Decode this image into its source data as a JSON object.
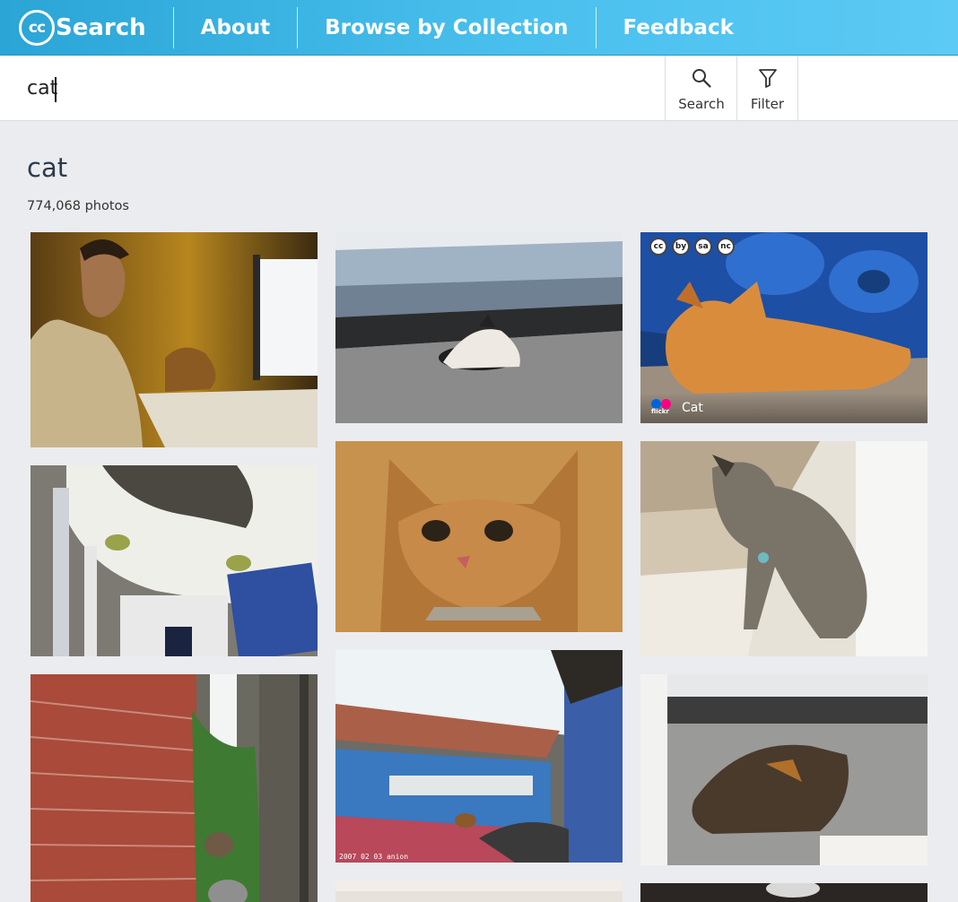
{
  "header": {
    "logo_badge": "cc",
    "logo_text": "Search",
    "nav": [
      {
        "label": "About"
      },
      {
        "label": "Browse by Collection"
      },
      {
        "label": "Feedback"
      }
    ]
  },
  "search": {
    "value": "cat",
    "search_button": "Search",
    "filter_button": "Filter"
  },
  "results": {
    "title": "cat",
    "count": "774,068 photos"
  },
  "hover_card": {
    "license_icons": [
      "cc",
      "by",
      "sa",
      "nc"
    ],
    "provider_word": "flickr",
    "caption": "Cat"
  },
  "colors": {
    "header": "#3bb5e5",
    "page_background": "#ebecef",
    "flickr_blue": "#0063dc",
    "flickr_pink": "#ff0084"
  }
}
